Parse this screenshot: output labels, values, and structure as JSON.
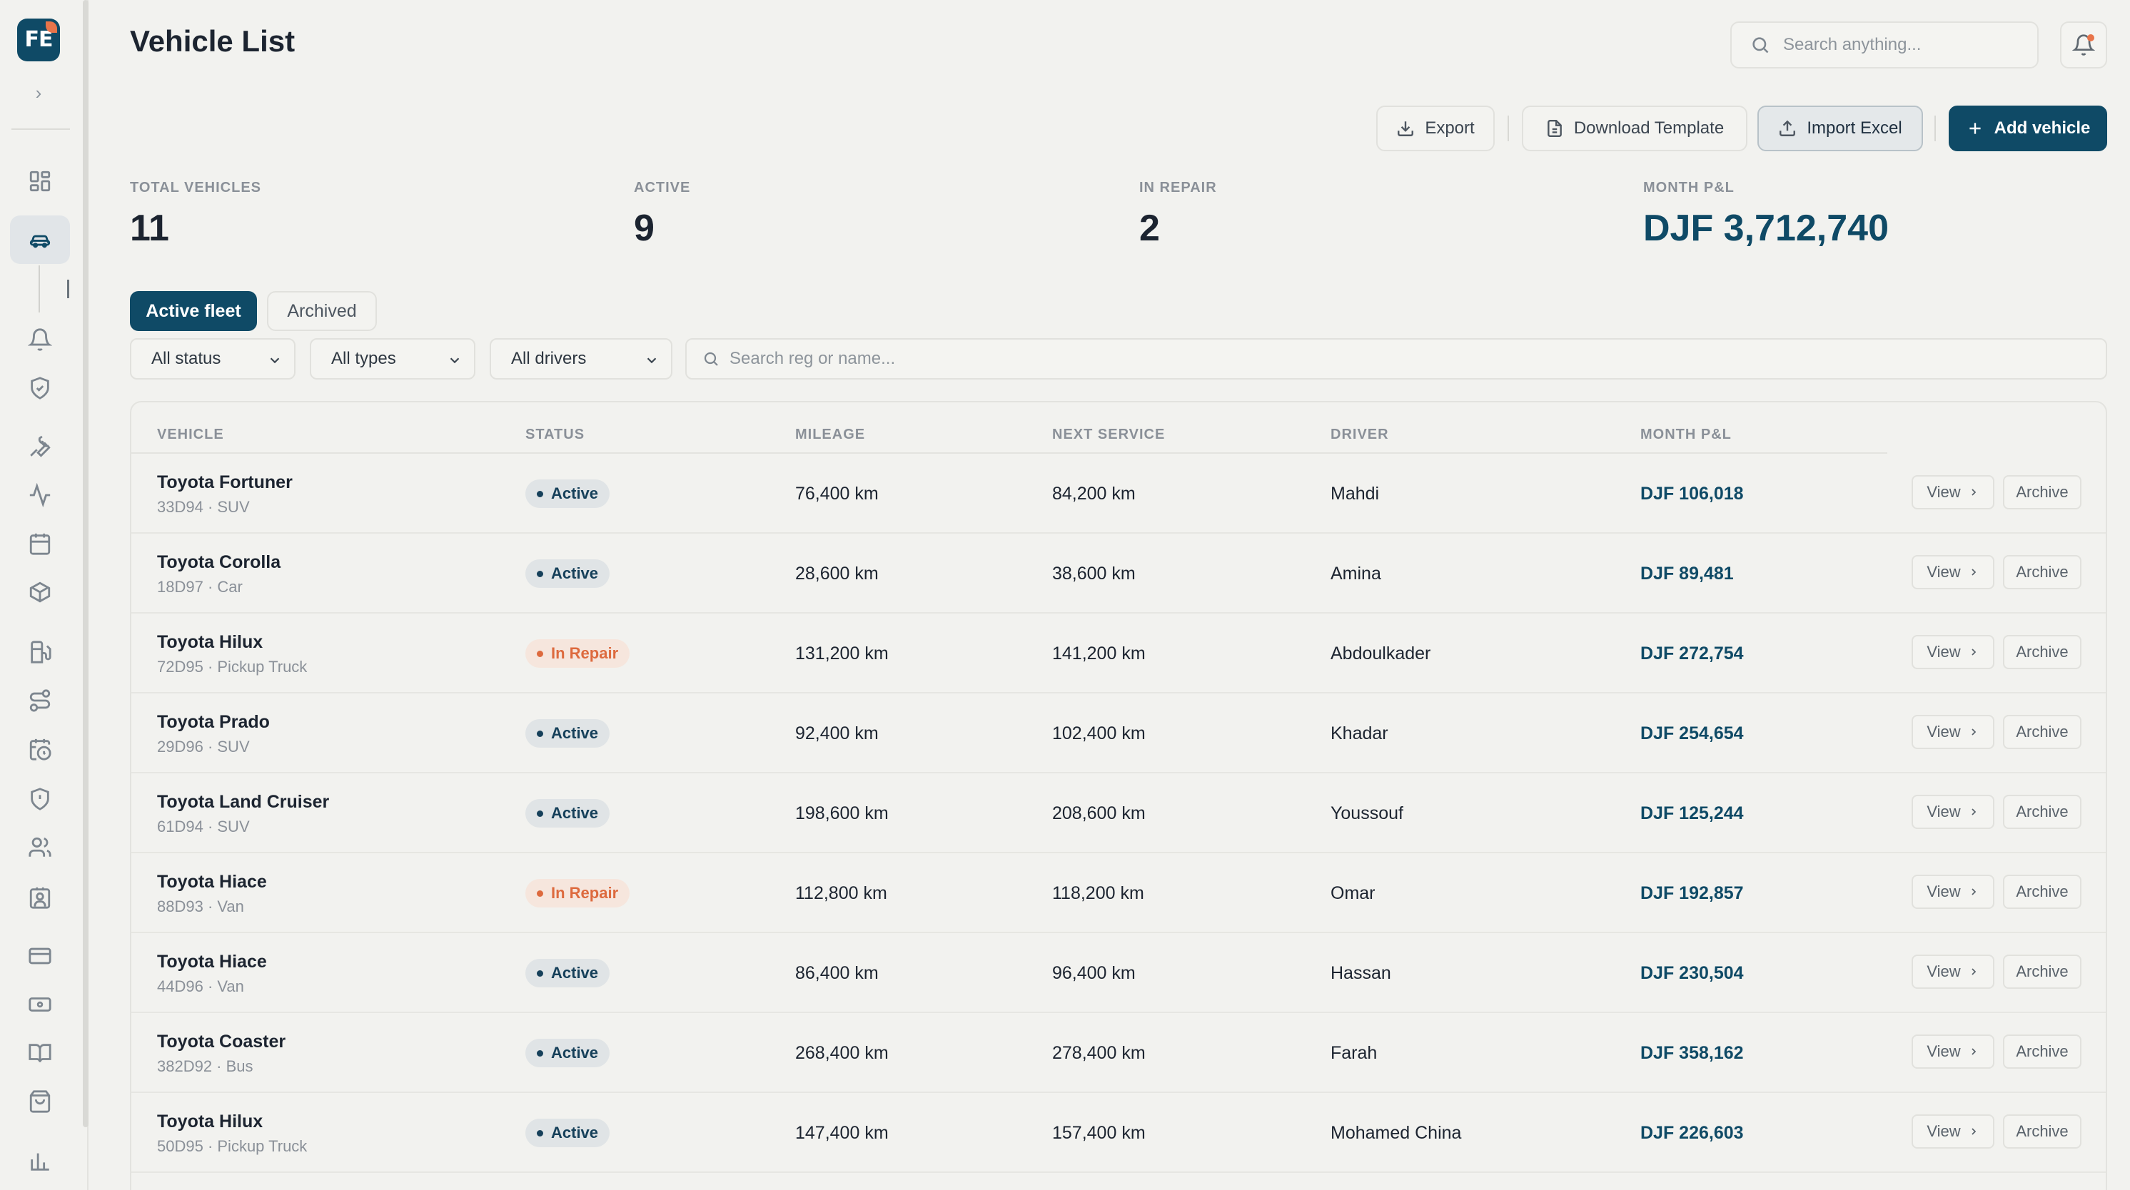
{
  "sidebar": {
    "logo_text": "FE",
    "brand_color": "#0f4a66",
    "accent_color": "#e8744a",
    "icons": [
      "dashboard-icon",
      "car-icon",
      "bell-icon",
      "shield-check-icon",
      "wrench-icon",
      "activity-icon",
      "calendar-icon",
      "box-icon",
      "fuel-icon",
      "route-icon",
      "calendar-clock-icon",
      "shield-icon",
      "users-icon",
      "id-badge-icon",
      "credit-card-icon",
      "banknote-icon",
      "book-icon",
      "shopping-bag-icon",
      "bar-chart-icon"
    ]
  },
  "header": {
    "title": "Vehicle List",
    "search_placeholder": "Search anything..."
  },
  "toolbar": {
    "export": "Export",
    "download_template": "Download Template",
    "import_excel": "Import Excel",
    "add_vehicle": "Add vehicle"
  },
  "stats": {
    "total_label": "TOTAL VEHICLES",
    "total_value": "11",
    "active_label": "ACTIVE",
    "active_value": "9",
    "repair_label": "IN REPAIR",
    "repair_value": "2",
    "pl_label": "MONTH P&L",
    "pl_value": "DJF 3,712,740"
  },
  "tabs": {
    "active": "Active fleet",
    "archived": "Archived"
  },
  "filters": {
    "status": "All status",
    "types": "All types",
    "drivers": "All drivers",
    "search_placeholder": "Search reg or name..."
  },
  "table": {
    "headers": {
      "vehicle": "VEHICLE",
      "status": "STATUS",
      "mileage": "MILEAGE",
      "next_service": "NEXT SERVICE",
      "driver": "DRIVER",
      "pl": "MONTH P&L"
    },
    "view_label": "View",
    "archive_label": "Archive",
    "rows": [
      {
        "name": "Toyota Fortuner",
        "sub": "33D94 · SUV",
        "status": "Active",
        "status_kind": "ok",
        "mileage": "76,400 km",
        "next": "84,200 km",
        "driver": "Mahdi",
        "pl": "DJF 106,018"
      },
      {
        "name": "Toyota Corolla",
        "sub": "18D97 · Car",
        "status": "Active",
        "status_kind": "ok",
        "mileage": "28,600 km",
        "next": "38,600 km",
        "driver": "Amina",
        "pl": "DJF 89,481"
      },
      {
        "name": "Toyota Hilux",
        "sub": "72D95 · Pickup Truck",
        "status": "In Repair",
        "status_kind": "repair",
        "mileage": "131,200 km",
        "next": "141,200 km",
        "driver": "Abdoulkader",
        "pl": "DJF 272,754"
      },
      {
        "name": "Toyota Prado",
        "sub": "29D96 · SUV",
        "status": "Active",
        "status_kind": "ok",
        "mileage": "92,400 km",
        "next": "102,400 km",
        "driver": "Khadar",
        "pl": "DJF 254,654"
      },
      {
        "name": "Toyota Land Cruiser",
        "sub": "61D94 · SUV",
        "status": "Active",
        "status_kind": "ok",
        "mileage": "198,600 km",
        "next": "208,600 km",
        "driver": "Youssouf",
        "pl": "DJF 125,244"
      },
      {
        "name": "Toyota Hiace",
        "sub": "88D93 · Van",
        "status": "In Repair",
        "status_kind": "repair",
        "mileage": "112,800 km",
        "next": "118,200 km",
        "driver": "Omar",
        "pl": "DJF 192,857"
      },
      {
        "name": "Toyota Hiace",
        "sub": "44D96 · Van",
        "status": "Active",
        "status_kind": "ok",
        "mileage": "86,400 km",
        "next": "96,400 km",
        "driver": "Hassan",
        "pl": "DJF 230,504"
      },
      {
        "name": "Toyota Coaster",
        "sub": "382D92 · Bus",
        "status": "Active",
        "status_kind": "ok",
        "mileage": "268,400 km",
        "next": "278,400 km",
        "driver": "Farah",
        "pl": "DJF 358,162"
      },
      {
        "name": "Toyota Hilux",
        "sub": "50D95 · Pickup Truck",
        "status": "Active",
        "status_kind": "ok",
        "mileage": "147,400 km",
        "next": "157,400 km",
        "driver": "Mohamed China",
        "pl": "DJF 226,603"
      }
    ]
  }
}
